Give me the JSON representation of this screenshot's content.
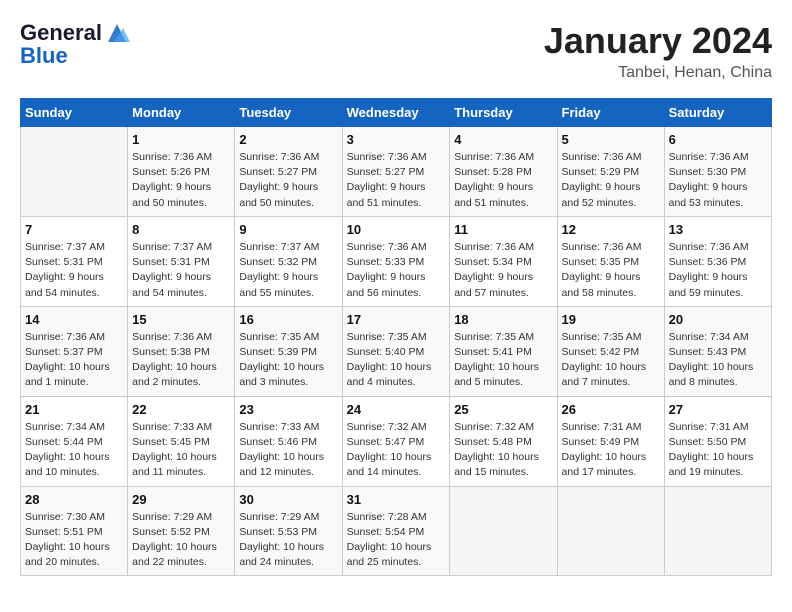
{
  "header": {
    "logo_line1": "General",
    "logo_line2": "Blue",
    "main_title": "January 2024",
    "subtitle": "Tanbei, Henan, China"
  },
  "calendar": {
    "weekdays": [
      "Sunday",
      "Monday",
      "Tuesday",
      "Wednesday",
      "Thursday",
      "Friday",
      "Saturday"
    ],
    "rows": [
      [
        {
          "day": "",
          "sunrise": "",
          "sunset": "",
          "daylight": ""
        },
        {
          "day": "1",
          "sunrise": "Sunrise: 7:36 AM",
          "sunset": "Sunset: 5:26 PM",
          "daylight": "Daylight: 9 hours and 50 minutes."
        },
        {
          "day": "2",
          "sunrise": "Sunrise: 7:36 AM",
          "sunset": "Sunset: 5:27 PM",
          "daylight": "Daylight: 9 hours and 50 minutes."
        },
        {
          "day": "3",
          "sunrise": "Sunrise: 7:36 AM",
          "sunset": "Sunset: 5:27 PM",
          "daylight": "Daylight: 9 hours and 51 minutes."
        },
        {
          "day": "4",
          "sunrise": "Sunrise: 7:36 AM",
          "sunset": "Sunset: 5:28 PM",
          "daylight": "Daylight: 9 hours and 51 minutes."
        },
        {
          "day": "5",
          "sunrise": "Sunrise: 7:36 AM",
          "sunset": "Sunset: 5:29 PM",
          "daylight": "Daylight: 9 hours and 52 minutes."
        },
        {
          "day": "6",
          "sunrise": "Sunrise: 7:36 AM",
          "sunset": "Sunset: 5:30 PM",
          "daylight": "Daylight: 9 hours and 53 minutes."
        }
      ],
      [
        {
          "day": "7",
          "sunrise": "Sunrise: 7:37 AM",
          "sunset": "Sunset: 5:31 PM",
          "daylight": "Daylight: 9 hours and 54 minutes."
        },
        {
          "day": "8",
          "sunrise": "Sunrise: 7:37 AM",
          "sunset": "Sunset: 5:31 PM",
          "daylight": "Daylight: 9 hours and 54 minutes."
        },
        {
          "day": "9",
          "sunrise": "Sunrise: 7:37 AM",
          "sunset": "Sunset: 5:32 PM",
          "daylight": "Daylight: 9 hours and 55 minutes."
        },
        {
          "day": "10",
          "sunrise": "Sunrise: 7:36 AM",
          "sunset": "Sunset: 5:33 PM",
          "daylight": "Daylight: 9 hours and 56 minutes."
        },
        {
          "day": "11",
          "sunrise": "Sunrise: 7:36 AM",
          "sunset": "Sunset: 5:34 PM",
          "daylight": "Daylight: 9 hours and 57 minutes."
        },
        {
          "day": "12",
          "sunrise": "Sunrise: 7:36 AM",
          "sunset": "Sunset: 5:35 PM",
          "daylight": "Daylight: 9 hours and 58 minutes."
        },
        {
          "day": "13",
          "sunrise": "Sunrise: 7:36 AM",
          "sunset": "Sunset: 5:36 PM",
          "daylight": "Daylight: 9 hours and 59 minutes."
        }
      ],
      [
        {
          "day": "14",
          "sunrise": "Sunrise: 7:36 AM",
          "sunset": "Sunset: 5:37 PM",
          "daylight": "Daylight: 10 hours and 1 minute."
        },
        {
          "day": "15",
          "sunrise": "Sunrise: 7:36 AM",
          "sunset": "Sunset: 5:38 PM",
          "daylight": "Daylight: 10 hours and 2 minutes."
        },
        {
          "day": "16",
          "sunrise": "Sunrise: 7:35 AM",
          "sunset": "Sunset: 5:39 PM",
          "daylight": "Daylight: 10 hours and 3 minutes."
        },
        {
          "day": "17",
          "sunrise": "Sunrise: 7:35 AM",
          "sunset": "Sunset: 5:40 PM",
          "daylight": "Daylight: 10 hours and 4 minutes."
        },
        {
          "day": "18",
          "sunrise": "Sunrise: 7:35 AM",
          "sunset": "Sunset: 5:41 PM",
          "daylight": "Daylight: 10 hours and 5 minutes."
        },
        {
          "day": "19",
          "sunrise": "Sunrise: 7:35 AM",
          "sunset": "Sunset: 5:42 PM",
          "daylight": "Daylight: 10 hours and 7 minutes."
        },
        {
          "day": "20",
          "sunrise": "Sunrise: 7:34 AM",
          "sunset": "Sunset: 5:43 PM",
          "daylight": "Daylight: 10 hours and 8 minutes."
        }
      ],
      [
        {
          "day": "21",
          "sunrise": "Sunrise: 7:34 AM",
          "sunset": "Sunset: 5:44 PM",
          "daylight": "Daylight: 10 hours and 10 minutes."
        },
        {
          "day": "22",
          "sunrise": "Sunrise: 7:33 AM",
          "sunset": "Sunset: 5:45 PM",
          "daylight": "Daylight: 10 hours and 11 minutes."
        },
        {
          "day": "23",
          "sunrise": "Sunrise: 7:33 AM",
          "sunset": "Sunset: 5:46 PM",
          "daylight": "Daylight: 10 hours and 12 minutes."
        },
        {
          "day": "24",
          "sunrise": "Sunrise: 7:32 AM",
          "sunset": "Sunset: 5:47 PM",
          "daylight": "Daylight: 10 hours and 14 minutes."
        },
        {
          "day": "25",
          "sunrise": "Sunrise: 7:32 AM",
          "sunset": "Sunset: 5:48 PM",
          "daylight": "Daylight: 10 hours and 15 minutes."
        },
        {
          "day": "26",
          "sunrise": "Sunrise: 7:31 AM",
          "sunset": "Sunset: 5:49 PM",
          "daylight": "Daylight: 10 hours and 17 minutes."
        },
        {
          "day": "27",
          "sunrise": "Sunrise: 7:31 AM",
          "sunset": "Sunset: 5:50 PM",
          "daylight": "Daylight: 10 hours and 19 minutes."
        }
      ],
      [
        {
          "day": "28",
          "sunrise": "Sunrise: 7:30 AM",
          "sunset": "Sunset: 5:51 PM",
          "daylight": "Daylight: 10 hours and 20 minutes."
        },
        {
          "day": "29",
          "sunrise": "Sunrise: 7:29 AM",
          "sunset": "Sunset: 5:52 PM",
          "daylight": "Daylight: 10 hours and 22 minutes."
        },
        {
          "day": "30",
          "sunrise": "Sunrise: 7:29 AM",
          "sunset": "Sunset: 5:53 PM",
          "daylight": "Daylight: 10 hours and 24 minutes."
        },
        {
          "day": "31",
          "sunrise": "Sunrise: 7:28 AM",
          "sunset": "Sunset: 5:54 PM",
          "daylight": "Daylight: 10 hours and 25 minutes."
        },
        {
          "day": "",
          "sunrise": "",
          "sunset": "",
          "daylight": ""
        },
        {
          "day": "",
          "sunrise": "",
          "sunset": "",
          "daylight": ""
        },
        {
          "day": "",
          "sunrise": "",
          "sunset": "",
          "daylight": ""
        }
      ]
    ]
  }
}
